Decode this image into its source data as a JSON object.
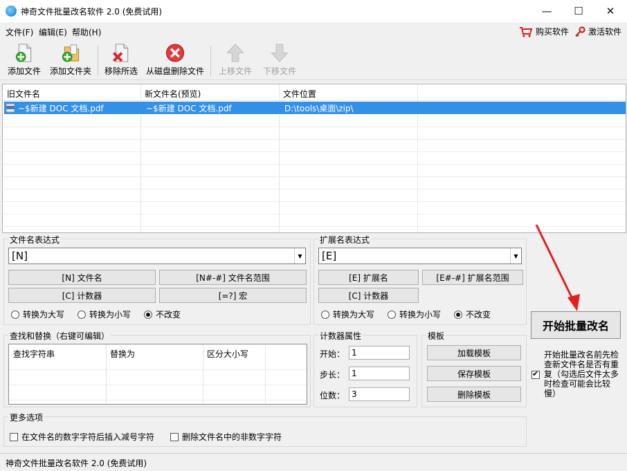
{
  "window": {
    "title": "神奇文件批量改名软件 2.0 (免费试用)",
    "minimize": "—",
    "maximize": "☐",
    "close": "✕"
  },
  "menu": {
    "file": "文件(F)",
    "edit": "编辑(E)",
    "help": "帮助(H)",
    "buy": "购买软件",
    "activate": "激活软件"
  },
  "toolbar": {
    "add_file": "添加文件",
    "add_folder": "添加文件夹",
    "remove_selected": "移除所选",
    "delete_from_disk": "从磁盘删除文件",
    "move_up": "上移文件",
    "move_down": "下移文件"
  },
  "file_list": {
    "columns": [
      "旧文件名",
      "新文件名(预览)",
      "文件位置"
    ],
    "rows": [
      {
        "old_name": "~$新建 DOC 文档.pdf",
        "new_name": "~$新建 DOC 文档.pdf",
        "location": "D:\\tools\\桌面\\zip\\",
        "selected": true,
        "icon": "pdf-file-icon"
      }
    ]
  },
  "filename_expr": {
    "title": "文件名表达式",
    "value": "[N]",
    "btn_name": "[N] 文件名",
    "btn_range": "[N#-#] 文件名范围",
    "btn_counter": "[C] 计数器",
    "btn_macro": "[=?] 宏",
    "radio_upper": "转换为大写",
    "radio_lower": "转换为小写",
    "radio_keep": "不改变",
    "selected_case": "keep"
  },
  "ext_expr": {
    "title": "扩展名表达式",
    "value": "[E]",
    "btn_ext": "[E] 扩展名",
    "btn_range": "[E#-#] 扩展名范围",
    "btn_counter": "[C] 计数器",
    "radio_upper": "转换为大写",
    "radio_lower": "转换为小写",
    "radio_keep": "不改变",
    "selected_case": "keep"
  },
  "find_replace": {
    "title": "查找和替换（右键可编辑）",
    "columns": [
      "查找字符串",
      "替换为",
      "区分大小写"
    ]
  },
  "counter": {
    "title": "计数器属性",
    "start_label": "开始：",
    "start_value": "1",
    "step_label": "步长：",
    "step_value": "1",
    "digits_label": "位数：",
    "digits_value": "3"
  },
  "template": {
    "title": "模板",
    "load": "加载模板",
    "save": "保存模板",
    "delete": "删除模板"
  },
  "more_options": {
    "title": "更多选项",
    "opt_insert_minus": "在文件名的数字字符后插入减号字符",
    "opt_delete_non_digit": "删除文件名中的非数字字符"
  },
  "start": {
    "label": "开始批量改名",
    "check_note": "开始批量改名前先检查新文件名是否有重复（勾选后文件太多时检查可能会比较慢）"
  },
  "status": {
    "text": "神奇文件批量改名软件 2.0 (免费试用)"
  },
  "colors": {
    "selection": "#3390e6",
    "annotation_arrow": "#e02020"
  }
}
